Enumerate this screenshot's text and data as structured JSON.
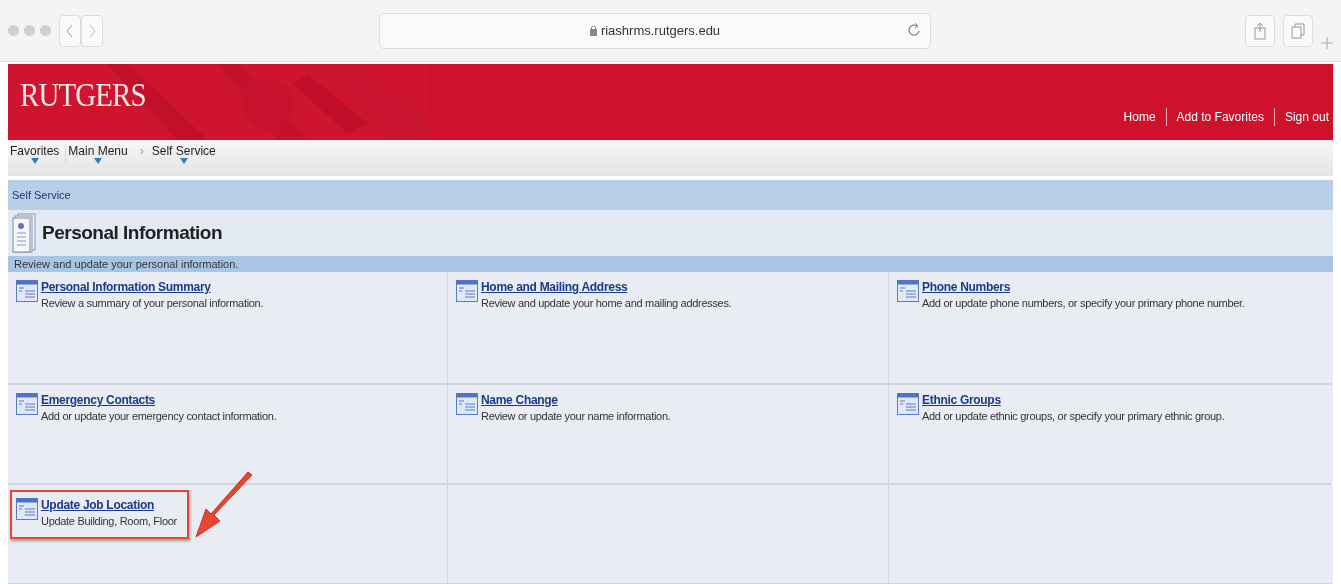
{
  "browser": {
    "address": "riashrms.rutgers.edu"
  },
  "header": {
    "logo": "RUTGERS",
    "links": [
      "Home",
      "Add to Favorites",
      "Sign out"
    ]
  },
  "nav": {
    "separator": "›",
    "items": [
      {
        "label": "Favorites",
        "dropdown": true
      },
      {
        "label": "Main Menu",
        "dropdown": true
      },
      {
        "label": "Self Service",
        "dropdown": true
      }
    ]
  },
  "breadcrumb": "Self Service",
  "section": {
    "title": "Personal Information",
    "description": "Review and update your personal information."
  },
  "tiles": [
    {
      "title": "Personal Information Summary",
      "description": "Review a summary of your personal information.",
      "highlighted": false
    },
    {
      "title": "Home and Mailing Address",
      "description": "Review and update your home and mailing addresses.",
      "highlighted": false
    },
    {
      "title": "Phone Numbers",
      "description": "Add or update phone numbers, or specify your primary phone number.",
      "highlighted": false
    },
    {
      "title": "Emergency Contacts",
      "description": "Add or update your emergency contact information.",
      "highlighted": false
    },
    {
      "title": "Name Change",
      "description": "Review or update your name information.",
      "highlighted": false
    },
    {
      "title": "Ethnic Groups",
      "description": "Add or update ethnic groups, or specify your primary ethnic group.",
      "highlighted": false
    },
    {
      "title": "Update Job Location",
      "description": "Update Building, Room, Floor",
      "highlighted": true
    }
  ]
}
